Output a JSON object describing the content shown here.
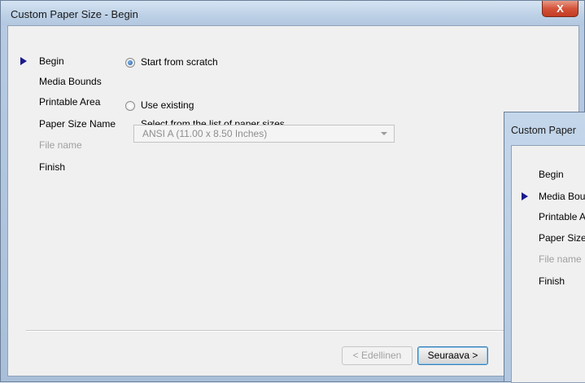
{
  "window": {
    "title": "Custom Paper Size - Begin",
    "close_label": "X"
  },
  "nav": {
    "items": [
      {
        "label": "Begin",
        "current": true,
        "disabled": false
      },
      {
        "label": "Media Bounds",
        "current": false,
        "disabled": false
      },
      {
        "label": "Printable Area",
        "current": false,
        "disabled": false
      },
      {
        "label": "Paper Size Name",
        "current": false,
        "disabled": false
      },
      {
        "label": "File name",
        "current": false,
        "disabled": true
      },
      {
        "label": "Finish",
        "current": false,
        "disabled": false
      }
    ]
  },
  "options": {
    "scratch_label": "Start from scratch",
    "scratch_selected": true,
    "existing_label": "Use existing",
    "existing_selected": false,
    "existing_hint": "Select from the list of paper sizes.",
    "paper_size_value": "ANSI A (11.00 x 8.50 Inches)"
  },
  "buttons": {
    "back_label": "< Edellinen",
    "next_label": "Seuraava >"
  },
  "second_window": {
    "title": "Custom Paper",
    "items": [
      {
        "label": "Begin",
        "current": false,
        "disabled": false
      },
      {
        "label": "Media Bou",
        "current": true,
        "disabled": false
      },
      {
        "label": "Printable A",
        "current": false,
        "disabled": false
      },
      {
        "label": "Paper Size",
        "current": false,
        "disabled": false
      },
      {
        "label": "File name",
        "current": false,
        "disabled": true
      },
      {
        "label": "Finish",
        "current": false,
        "disabled": false
      }
    ]
  },
  "colors": {
    "nav_arrow": "#1a1a8c",
    "disabled_text": "#a0a0a0",
    "close_button": "#c23b22"
  },
  "icons": {
    "current_step": "triangle-right-icon",
    "close": "close-icon",
    "dropdown": "chevron-down-icon"
  }
}
